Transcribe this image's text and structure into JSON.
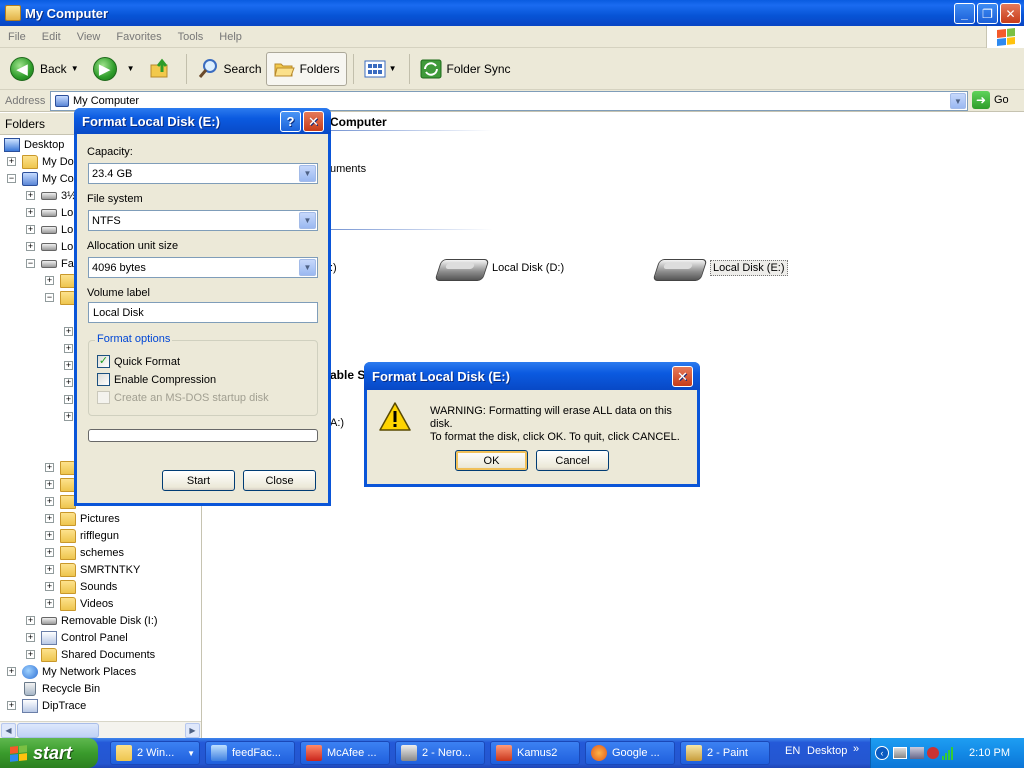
{
  "window": {
    "title": "My Computer"
  },
  "menu": [
    "File",
    "Edit",
    "View",
    "Favorites",
    "Tools",
    "Help"
  ],
  "toolbar": {
    "back": "Back",
    "search": "Search",
    "folders": "Folders",
    "folder_sync": "Folder Sync"
  },
  "address": {
    "label": "Address",
    "value": "My Computer",
    "go": "Go"
  },
  "folders_pane": {
    "header": "Folders",
    "items": [
      {
        "label": "Desktop"
      },
      {
        "label": "My Doc"
      },
      {
        "label": "My Com"
      },
      {
        "label": "3½"
      },
      {
        "label": "Lo"
      },
      {
        "label": "Lo"
      },
      {
        "label": "Lo"
      },
      {
        "label": "Fa"
      },
      {
        "label": "Pictures"
      },
      {
        "label": "rifflegun"
      },
      {
        "label": "schemes"
      },
      {
        "label": "SMRTNTKY"
      },
      {
        "label": "Sounds"
      },
      {
        "label": "Videos"
      },
      {
        "label": "Removable Disk (I:)"
      },
      {
        "label": "Control Panel"
      },
      {
        "label": "Shared Documents"
      },
      {
        "label": "My Network Places"
      },
      {
        "label": "Recycle Bin"
      },
      {
        "label": "DipTrace"
      }
    ]
  },
  "content": {
    "header_partial": "Computer",
    "documents_partial": "uments",
    "drive_c_partial": ":)",
    "drive_d": "Local Disk (D:)",
    "drive_e": "Local Disk (E:)",
    "removable_partial": "able S",
    "floppy_partial": "A:)"
  },
  "format_dialog": {
    "title": "Format Local Disk (E:)",
    "capacity_label": "Capacity:",
    "capacity_value": "23.4 GB",
    "filesystem_label": "File system",
    "filesystem_value": "NTFS",
    "allocation_label": "Allocation unit size",
    "allocation_value": "4096 bytes",
    "volume_label": "Volume label",
    "volume_value": "Local Disk",
    "options_title": "Format options",
    "quick_format": "Quick Format",
    "quick_format_checked": true,
    "enable_compression": "Enable Compression",
    "msdos_disk": "Create an MS-DOS startup disk",
    "progress": 0,
    "start": "Start",
    "close": "Close"
  },
  "warning_dialog": {
    "title": "Format Local Disk (E:)",
    "line1": "WARNING: Formatting will erase ALL data on this disk.",
    "line2": "To format the disk, click OK. To quit, click CANCEL.",
    "ok": "OK",
    "cancel": "Cancel"
  },
  "taskbar": {
    "start": "start",
    "tasks": [
      "2 Win...",
      "feedFac...",
      "McAfee ...",
      "2 - Nero...",
      "Kamus2",
      "Google ...",
      "2 - Paint"
    ],
    "lang": "EN",
    "desktop": "Desktop",
    "time": "2:10 PM"
  }
}
